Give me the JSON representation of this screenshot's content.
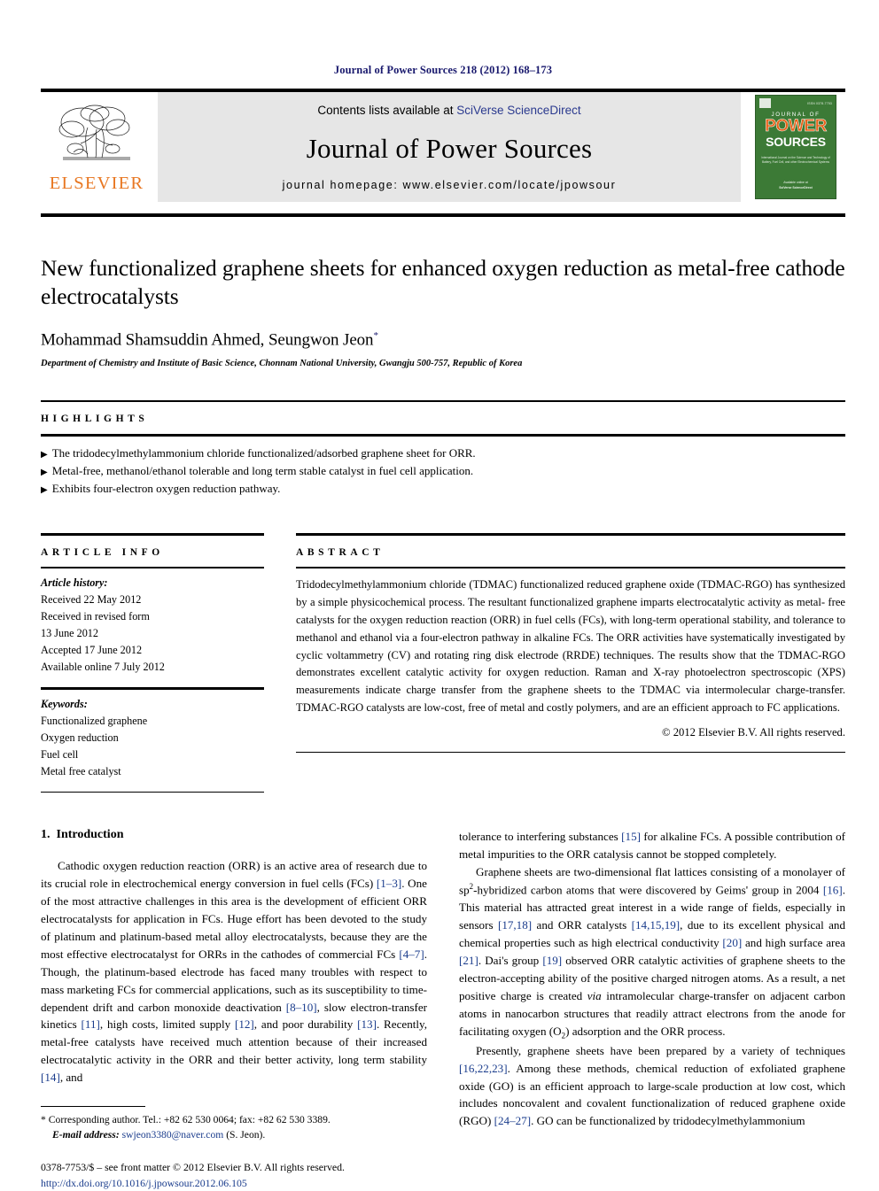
{
  "running_head": "Journal of Power Sources 218 (2012) 168–173",
  "masthead": {
    "publisher_name": "ELSEVIER",
    "contents_prefix": "Contents lists available at ",
    "contents_link": "SciVerse ScienceDirect",
    "journal_title": "Journal of Power Sources",
    "homepage": "journal homepage: www.elsevier.com/locate/jpowsour",
    "cover": {
      "issn": "ISSN 0378-7753",
      "journal_of": "JOURNAL OF",
      "power": "POWER",
      "sources": "SOURCES",
      "subtitle": "International Journal on the Science and Technology of Battery, Fuel Cell, and other Electrochemical Systems",
      "foot_top": "Available online at",
      "foot_bottom": "SciVerse ScienceDirect"
    }
  },
  "article": {
    "title": "New functionalized graphene sheets for enhanced oxygen reduction as metal-free cathode electrocatalysts",
    "authors": "Mohammad Shamsuddin Ahmed, Seungwon Jeon",
    "author_marker": "*",
    "affiliation": "Department of Chemistry and Institute of Basic Science, Chonnam National University, Gwangju 500-757, Republic of Korea"
  },
  "highlights": {
    "label": "HIGHLIGHTS",
    "bullet": "▶",
    "items": [
      "The tridodecylmethylammonium chloride functionalized/adsorbed graphene sheet for ORR.",
      "Metal-free, methanol/ethanol tolerable and long term stable catalyst in fuel cell application.",
      "Exhibits four-electron oxygen reduction pathway."
    ]
  },
  "article_info": {
    "label": "ARTICLE INFO",
    "history_title": "Article history:",
    "history": [
      "Received 22 May 2012",
      "Received in revised form",
      "13 June 2012",
      "Accepted 17 June 2012",
      "Available online 7 July 2012"
    ],
    "keywords_title": "Keywords:",
    "keywords": [
      "Functionalized graphene",
      "Oxygen reduction",
      "Fuel cell",
      "Metal free catalyst"
    ]
  },
  "abstract": {
    "label": "ABSTRACT",
    "text": "Tridodecylmethylammonium chloride (TDMAC) functionalized reduced graphene oxide (TDMAC-RGO) has synthesized by a simple physicochemical process. The resultant functionalized graphene imparts electrocatalytic activity as metal- free catalysts for the oxygen reduction reaction (ORR) in fuel cells (FCs), with long-term operational stability, and tolerance to methanol and ethanol via a four-electron pathway in alkaline FCs. The ORR activities have systematically investigated by cyclic voltammetry (CV) and rotating ring disk electrode (RRDE) techniques. The results show that the TDMAC-RGO demonstrates excellent catalytic activity for oxygen reduction. Raman and X-ray photoelectron spectroscopic (XPS) measurements indicate charge transfer from the graphene sheets to the TDMAC via intermolecular charge-transfer. TDMAC-RGO catalysts are low-cost, free of metal and costly polymers, and are an efficient approach to FC applications.",
    "copyright": "© 2012 Elsevier B.V. All rights reserved."
  },
  "introduction": {
    "section_number": "1.",
    "section_title": "Introduction",
    "left_paragraph_1_a": "Cathodic oxygen reduction reaction (ORR) is an active area of research due to its crucial role in electrochemical energy conversion in fuel cells (FCs) ",
    "ref_1_3": "[1–3]",
    "left_paragraph_1_b": ". One of the most attractive challenges in this area is the development of efficient ORR electrocatalysts for application in FCs. Huge effort has been devoted to the study of platinum and platinum-based metal alloy electrocatalysts, because they are the most effective electrocatalyst for ORRs in the cathodes of commercial FCs ",
    "ref_4_7": "[4–7]",
    "left_paragraph_1_c": ". Though, the platinum-based electrode has faced many troubles with respect to mass marketing FCs for commercial applications, such as its susceptibility to time-dependent drift and carbon monoxide deactivation ",
    "ref_8_10": "[8–10]",
    "left_paragraph_1_d": ", slow electron-transfer kinetics ",
    "ref_11": "[11]",
    "left_paragraph_1_e": ", high costs, limited supply ",
    "ref_12": "[12]",
    "left_paragraph_1_f": ", and poor durability ",
    "ref_13": "[13]",
    "left_paragraph_1_g": ". Recently, metal-free catalysts have received much attention because of their increased electrocatalytic activity in the ORR and their better activity, long term stability ",
    "ref_14": "[14]",
    "left_paragraph_1_h": ", and",
    "right_paragraph_1_a": "tolerance to interfering substances ",
    "ref_15": "[15]",
    "right_paragraph_1_b": " for alkaline FCs. A possible contribution of metal impurities to the ORR catalysis cannot be stopped completely.",
    "right_paragraph_2_a": "Graphene sheets are two-dimensional flat lattices consisting of a monolayer of sp",
    "sp_exponent": "2",
    "right_paragraph_2_b": "-hybridized carbon atoms that were discovered by Geims' group in 2004 ",
    "ref_16": "[16]",
    "right_paragraph_2_c": ". This material has attracted great interest in a wide range of fields, especially in sensors ",
    "ref_17_18": "[17,18]",
    "right_paragraph_2_d": " and ORR catalysts ",
    "ref_14_15_19": "[14,15,19]",
    "right_paragraph_2_e": ", due to its excellent physical and chemical properties such as high electrical conductivity ",
    "ref_20": "[20]",
    "right_paragraph_2_f": " and high surface area ",
    "ref_21": "[21]",
    "right_paragraph_2_g": ". Dai's group ",
    "ref_19": "[19]",
    "right_paragraph_2_h": " observed ORR catalytic activities of graphene sheets to the electron-accepting ability of the positive charged nitrogen atoms. As a result, a net positive charge is created ",
    "via_italic": "via",
    "right_paragraph_2_i": " intramolecular charge-transfer on adjacent carbon atoms in nanocarbon structures that readily attract electrons from the anode for facilitating oxygen (O",
    "o2_subscript": "2",
    "right_paragraph_2_j": ") adsorption and the ORR process.",
    "right_paragraph_3_a": "Presently, graphene sheets have been prepared by a variety of techniques ",
    "ref_16_22_23": "[16,22,23]",
    "right_paragraph_3_b": ". Among these methods, chemical reduction of exfoliated graphene oxide (GO) is an efficient approach to large-scale production at low cost, which includes noncovalent and covalent functionalization of reduced graphene oxide (RGO) ",
    "ref_24_27": "[24–27]",
    "right_paragraph_3_c": ". GO can be functionalized by tridodecylmethylammonium"
  },
  "footnotes": {
    "star": "*",
    "corresponding": "Corresponding author. Tel.: +82 62 530 0064; fax: +82 62 530 3389.",
    "email_label": "E-mail address:",
    "email": "swjeon3380@naver.com",
    "email_suffix": "(S. Jeon).",
    "front_matter": "0378-7753/$ – see front matter © 2012 Elsevier B.V. All rights reserved.",
    "doi": "http://dx.doi.org/10.1016/j.jpowsour.2012.06.105"
  }
}
